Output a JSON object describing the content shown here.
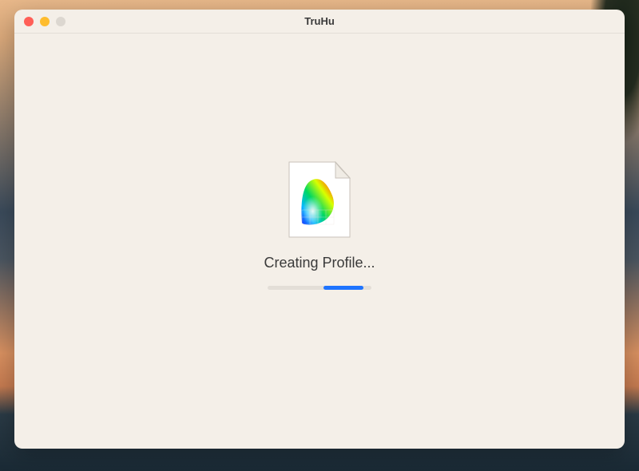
{
  "window": {
    "title": "TruHu"
  },
  "main": {
    "icon_name": "color-profile-file-icon",
    "status_text": "Creating Profile...",
    "progress": {
      "percent": 38,
      "segment_start": 54,
      "segment_end": 92,
      "track_color": "#e3ded7",
      "fill_color": "#1f74ff"
    }
  },
  "traffic_lights": {
    "close": "#ff5f57",
    "minimize": "#febc2e",
    "maximize": "#dcd7d0"
  }
}
